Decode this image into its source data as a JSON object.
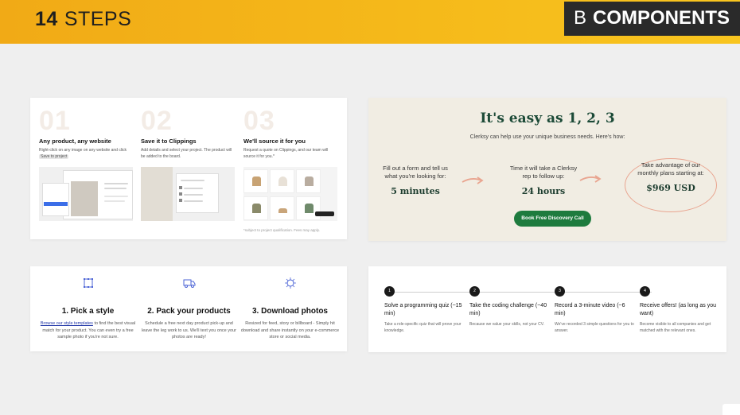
{
  "header": {
    "number": "14",
    "title": "STEPS",
    "badge_letter": "B",
    "badge_word": "COMPONENTS"
  },
  "card_clippings": {
    "steps": [
      {
        "num": "01",
        "title": "Any product, any website",
        "text": "Right-click on any image on any website and click",
        "pill": "Save to project"
      },
      {
        "num": "02",
        "title": "Save it to Clippings",
        "text": "Add details and select your project. The product will be added to the board."
      },
      {
        "num": "03",
        "title": "We'll source it for you",
        "text": "Request a quote on Clippings, and our team will source it for you.*"
      }
    ],
    "footnote": "*subject to project qualification. Fees may apply."
  },
  "card_clerksy": {
    "title": "It's easy as 1, 2, 3",
    "subtitle": "Clerksy can help use your unique business needs. Here's how:",
    "steps": [
      {
        "desc": "Fill out a form and tell us what you're looking for:",
        "value": "5 minutes"
      },
      {
        "desc": "Time it will take a Clerksy rep to follow up:",
        "value": "24 hours"
      },
      {
        "desc": "Take advantage of our monthly plans starting at:",
        "value": "$969 USD"
      }
    ],
    "cta": "Book Free Discovery Call",
    "accent": "#1e7b3e",
    "highlight": "#e9a590"
  },
  "card_photos": {
    "steps": [
      {
        "icon": "grid-select-icon",
        "title": "1. Pick a style",
        "link": "Browse our style templates",
        "text": "to find the best visual match for your product. You can even try a free sample photo if you're not sure."
      },
      {
        "icon": "truck-icon",
        "title": "2. Pack your products",
        "text": "Schedule a free next day product pick-up and leave the leg work to us. We'll text you once your photos are ready!"
      },
      {
        "icon": "download-sparkle-icon",
        "title": "3. Download photos",
        "text": "Resized for feed, story or billboard - Simply hit download and share instantly on your e-commerce store or social media."
      }
    ]
  },
  "card_quiz": {
    "steps": [
      {
        "n": "1",
        "title": "Solve a programming quiz (~15 min)",
        "text": "Take a role-specific quiz that will prove your knowledge."
      },
      {
        "n": "2",
        "title": "Take the coding challenge (~40 min)",
        "text": "Because we value your skills, not your CV."
      },
      {
        "n": "3",
        "title": "Record a 3-minute video (~6 min)",
        "text": "We've recorded 3 simple questions for you to answer."
      },
      {
        "n": "4",
        "title": "Receive offers! (as long as you want)",
        "text": "Become visible to all companies and get matched with the relevant ones."
      }
    ]
  }
}
